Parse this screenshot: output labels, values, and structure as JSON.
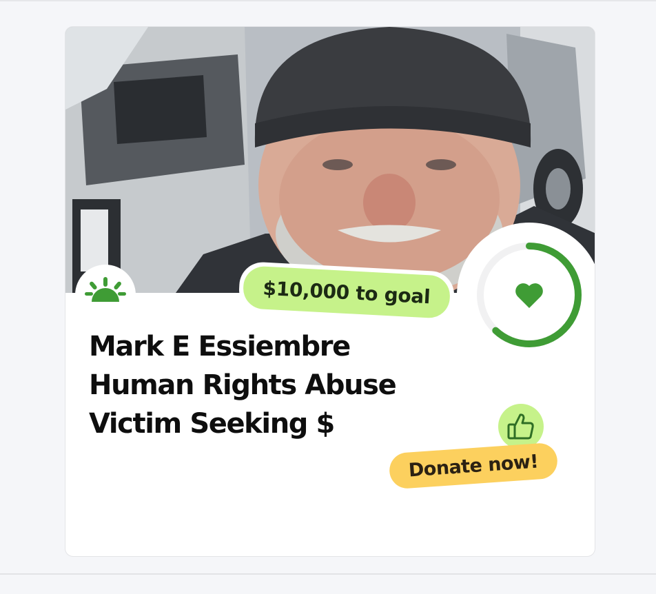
{
  "campaign": {
    "title_lines": [
      "Mark E Essiembre",
      "Human Rights Abuse",
      "Victim Seeking $"
    ],
    "goal_label": "$10,000 to goal",
    "progress_fraction": 0.62,
    "cta_label": "Donate now!"
  },
  "icons": {
    "brand": "sunrise-logo-icon",
    "progress_center": "heart-icon",
    "cta": "thumbs-up-icon"
  },
  "colors": {
    "accent_green": "#3f9c35",
    "pill_green": "#c6f28a",
    "cta_yellow": "#fcd05e",
    "ring_track": "#f1f1f2"
  }
}
